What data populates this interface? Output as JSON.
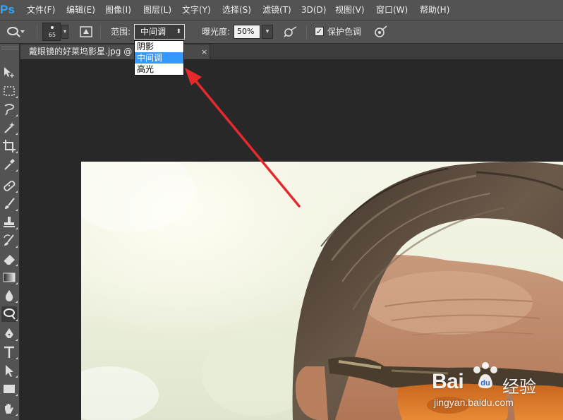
{
  "app": {
    "logo_text": "Ps"
  },
  "menubar": {
    "items": [
      "文件(F)",
      "编辑(E)",
      "图像(I)",
      "图层(L)",
      "文字(Y)",
      "选择(S)",
      "滤镜(T)",
      "3D(D)",
      "视图(V)",
      "窗口(W)",
      "帮助(H)"
    ]
  },
  "options": {
    "tool_icon": "dodge-tool-icon",
    "brush_size": "65",
    "range_label": "范围:",
    "range_value": "中间调",
    "exposure_label": "曝光度:",
    "exposure_value": "50%",
    "protect_tones_label": "保护色调",
    "protect_tones_checked": true
  },
  "range_dropdown": {
    "options": [
      "阴影",
      "中间调",
      "高光"
    ],
    "selected": "中间调"
  },
  "document_tab": {
    "title": "戴眼镜的好莱坞影星.jpg @",
    "title_suffix": "*",
    "close": "×"
  },
  "toolbox": {
    "tools": [
      "move-tool-icon",
      "marquee-tool-icon",
      "lasso-tool-icon",
      "magic-wand-tool-icon",
      "crop-tool-icon",
      "eyedropper-tool-icon",
      "healing-brush-tool-icon",
      "brush-tool-icon",
      "clone-stamp-tool-icon",
      "history-brush-tool-icon",
      "eraser-tool-icon",
      "gradient-tool-icon",
      "blur-tool-icon",
      "dodge-tool-icon",
      "pen-tool-icon",
      "type-tool-icon",
      "path-selection-tool-icon",
      "rectangle-tool-icon",
      "hand-tool-icon"
    ],
    "active_tool": "dodge-tool-icon"
  },
  "watermark": {
    "brand": "Bai",
    "brand_suffix": "经验",
    "url": "jingyan.baidu.com"
  },
  "colors": {
    "ui_panel": "#535353",
    "canvas_bg": "#282828",
    "dropdown_highlight": "#3399ff",
    "arrow": "#e8292c"
  }
}
